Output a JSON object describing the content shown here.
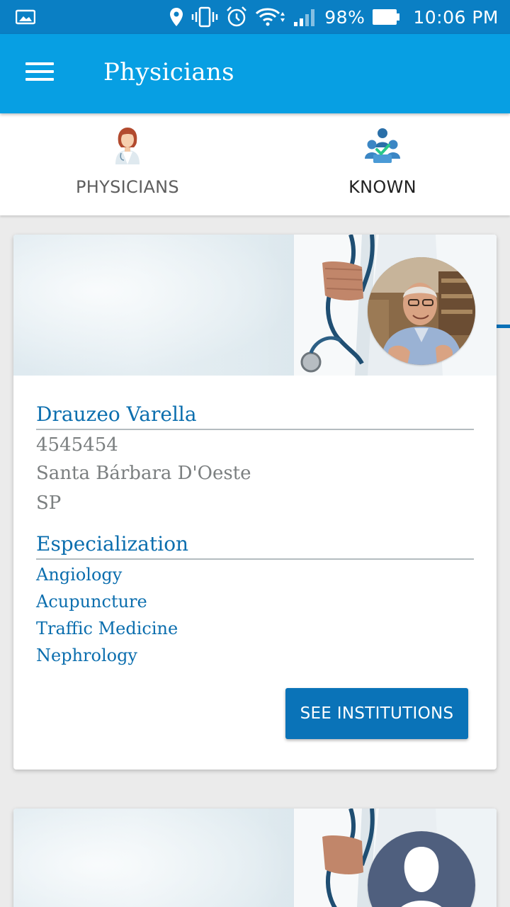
{
  "status_bar": {
    "battery": "98%",
    "time": "10:06 PM",
    "icons": [
      "image-icon",
      "location-icon",
      "vibrate-icon",
      "alarm-icon",
      "wifi-icon",
      "signal-icon",
      "battery-icon"
    ]
  },
  "app_bar": {
    "title": "Physicians",
    "menu_icon": "menu-icon",
    "background": "#079fe3"
  },
  "tabs": [
    {
      "label": "PHYSICIANS",
      "icon": "doctor-icon",
      "selected": false
    },
    {
      "label": "KNOWN",
      "icon": "known-group-icon",
      "selected": true
    }
  ],
  "cards": [
    {
      "name": "Drauzeo Varella",
      "details": [
        "4545454",
        "Santa Bárbara D'Oeste",
        "SP"
      ],
      "specialization_title": "Especialization",
      "specializations": [
        "Angiology",
        "Acupuncture",
        "Traffic Medicine",
        "Nephrology"
      ],
      "button_label": "SEE INSTITUTIONS",
      "avatar": "photo"
    },
    {
      "avatar": "placeholder-avatar-icon"
    }
  ],
  "colors": {
    "status_bar": "#0a7fc4",
    "accent": "#0a70b7",
    "link_text": "#0b6eae",
    "muted_text": "#7b7f80"
  }
}
